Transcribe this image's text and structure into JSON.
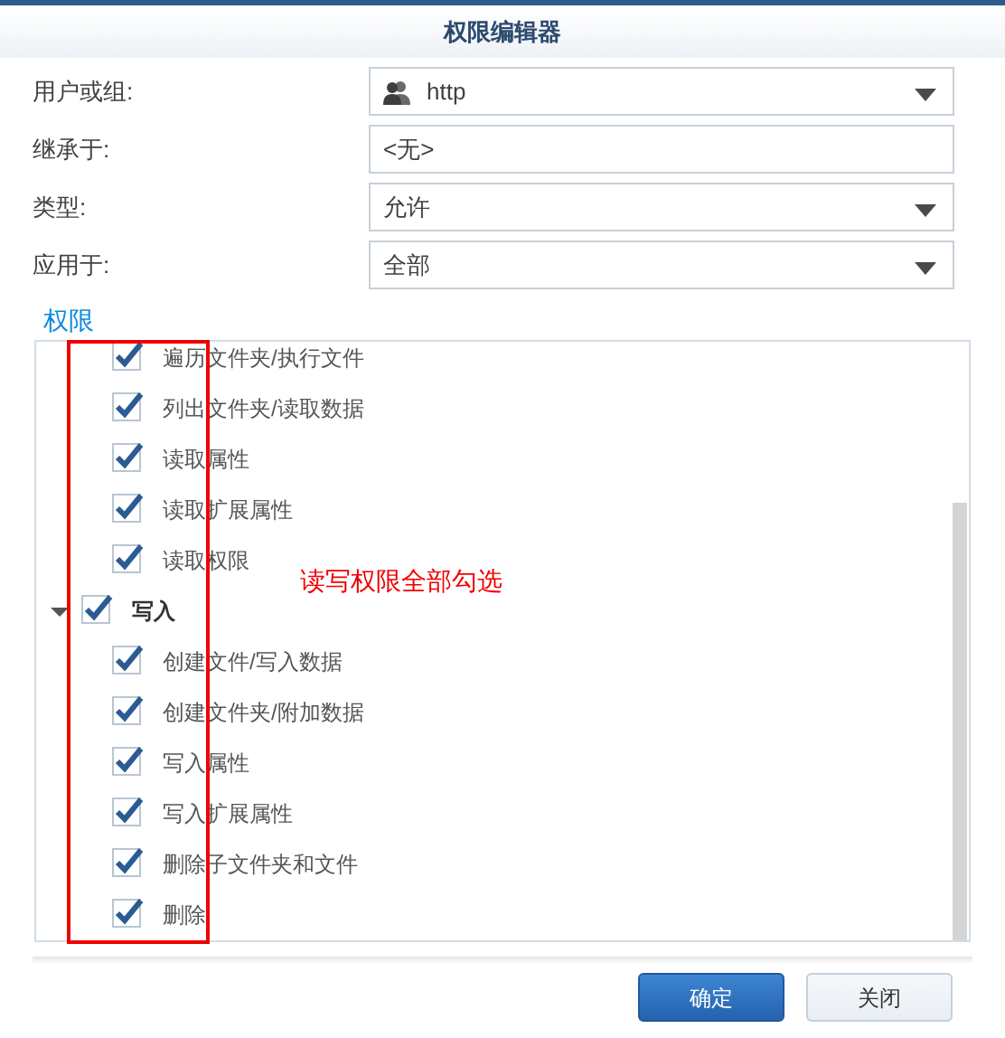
{
  "window": {
    "title": "权限编辑器"
  },
  "form": [
    {
      "label": "用户或组:",
      "value": "http",
      "kind": "user-select"
    },
    {
      "label": "继承于:",
      "value": "<无>",
      "kind": "text"
    },
    {
      "label": "类型:",
      "value": "允许",
      "kind": "select"
    },
    {
      "label": "应用于:",
      "value": "全部",
      "kind": "select"
    }
  ],
  "section_title": "权限",
  "tree": [
    {
      "label": "遍历文件夹/执行文件",
      "checked": true
    },
    {
      "label": "列出文件夹/读取数据",
      "checked": true
    },
    {
      "label": "读取属性",
      "checked": true
    },
    {
      "label": "读取扩展属性",
      "checked": true
    },
    {
      "label": "读取权限",
      "checked": true
    },
    {
      "label": "写入",
      "checked": true,
      "expanded": true,
      "children": [
        {
          "label": "创建文件/写入数据",
          "checked": true
        },
        {
          "label": "创建文件夹/附加数据",
          "checked": true
        },
        {
          "label": "写入属性",
          "checked": true
        },
        {
          "label": "写入扩展属性",
          "checked": true
        },
        {
          "label": "删除子文件夹和文件",
          "checked": true
        },
        {
          "label": "删除",
          "checked": true
        }
      ]
    }
  ],
  "annotation": "读写权限全部勾选",
  "buttons": [
    {
      "label": "确定",
      "kind": "primary"
    },
    {
      "label": "关闭",
      "kind": "secondary"
    }
  ]
}
